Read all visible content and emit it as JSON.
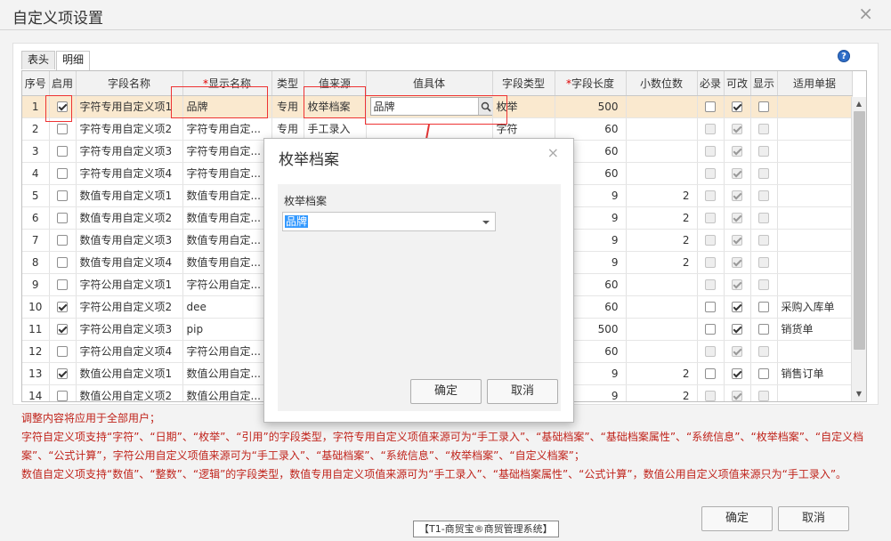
{
  "window": {
    "title": "自定义项设置",
    "close_glyph": "×"
  },
  "tabs": [
    {
      "label": "表头"
    },
    {
      "label": "明细"
    }
  ],
  "help_glyph": "?",
  "table": {
    "columns": [
      "序号",
      "启用",
      "字段名称",
      "显示名称",
      "类型",
      "值来源",
      "值具体",
      "字段类型",
      "字段长度",
      "小数位数",
      "必录",
      "可改",
      "显示",
      "适用单据"
    ],
    "required_mark": "*",
    "rows": [
      {
        "no": "1",
        "enabled": true,
        "field": "字符专用自定义项1",
        "display": "品牌",
        "type": "专用",
        "source": "枚举档案",
        "value": "品牌",
        "ftype": "枚举",
        "len": "500",
        "dec": "",
        "req": false,
        "edit": true,
        "show": false,
        "docs": ""
      },
      {
        "no": "2",
        "enabled": false,
        "field": "字符专用自定义项2",
        "display": "字符专用自定...",
        "type": "专用",
        "source": "手工录入",
        "value": "",
        "ftype": "字符",
        "len": "60",
        "dec": "",
        "req": false,
        "edit": true,
        "show": false,
        "docs": ""
      },
      {
        "no": "3",
        "enabled": false,
        "field": "字符专用自定义项3",
        "display": "字符专用自定...",
        "type": "",
        "source": "",
        "value": "",
        "ftype": "",
        "len": "60",
        "dec": "",
        "req": false,
        "edit": true,
        "show": false,
        "docs": ""
      },
      {
        "no": "4",
        "enabled": false,
        "field": "字符专用自定义项4",
        "display": "字符专用自定...",
        "type": "",
        "source": "",
        "value": "",
        "ftype": "",
        "len": "60",
        "dec": "",
        "req": false,
        "edit": true,
        "show": false,
        "docs": ""
      },
      {
        "no": "5",
        "enabled": false,
        "field": "数值专用自定义项1",
        "display": "数值专用自定...",
        "type": "",
        "source": "",
        "value": "",
        "ftype": "",
        "len": "9",
        "dec": "2",
        "req": false,
        "edit": true,
        "show": false,
        "docs": ""
      },
      {
        "no": "6",
        "enabled": false,
        "field": "数值专用自定义项2",
        "display": "数值专用自定...",
        "type": "",
        "source": "",
        "value": "",
        "ftype": "",
        "len": "9",
        "dec": "2",
        "req": false,
        "edit": true,
        "show": false,
        "docs": ""
      },
      {
        "no": "7",
        "enabled": false,
        "field": "数值专用自定义项3",
        "display": "数值专用自定...",
        "type": "",
        "source": "",
        "value": "",
        "ftype": "",
        "len": "9",
        "dec": "2",
        "req": false,
        "edit": true,
        "show": false,
        "docs": ""
      },
      {
        "no": "8",
        "enabled": false,
        "field": "数值专用自定义项4",
        "display": "数值专用自定...",
        "type": "",
        "source": "",
        "value": "",
        "ftype": "",
        "len": "9",
        "dec": "2",
        "req": false,
        "edit": true,
        "show": false,
        "docs": ""
      },
      {
        "no": "9",
        "enabled": false,
        "field": "字符公用自定义项1",
        "display": "字符公用自定...",
        "type": "",
        "source": "",
        "value": "",
        "ftype": "",
        "len": "60",
        "dec": "",
        "req": false,
        "edit": true,
        "show": false,
        "docs": ""
      },
      {
        "no": "10",
        "enabled": true,
        "field": "字符公用自定义项2",
        "display": "dee",
        "type": "",
        "source": "",
        "value": "",
        "ftype": "",
        "len": "60",
        "dec": "",
        "req": false,
        "edit": true,
        "show": false,
        "docs": "采购入库单"
      },
      {
        "no": "11",
        "enabled": true,
        "field": "字符公用自定义项3",
        "display": "pip",
        "type": "",
        "source": "",
        "value": "",
        "ftype": "",
        "len": "500",
        "dec": "",
        "req": false,
        "edit": true,
        "show": false,
        "docs": "销货单"
      },
      {
        "no": "12",
        "enabled": false,
        "field": "字符公用自定义项4",
        "display": "字符公用自定...",
        "type": "",
        "source": "",
        "value": "",
        "ftype": "",
        "len": "60",
        "dec": "",
        "req": false,
        "edit": true,
        "show": false,
        "docs": ""
      },
      {
        "no": "13",
        "enabled": true,
        "field": "数值公用自定义项1",
        "display": "数值公用自定...",
        "type": "",
        "source": "",
        "value": "",
        "ftype": "",
        "len": "9",
        "dec": "2",
        "req": false,
        "edit": true,
        "show": false,
        "docs": "销售订单"
      },
      {
        "no": "14",
        "enabled": false,
        "field": "数值公用自定义项2",
        "display": "数值公用自定...",
        "type": "",
        "source": "",
        "value": "",
        "ftype": "",
        "len": "9",
        "dec": "2",
        "req": false,
        "edit": true,
        "show": false,
        "docs": ""
      }
    ]
  },
  "dialog": {
    "title": "枚举档案",
    "close_glyph": "×",
    "field_label": "枚举档案",
    "selected": "品牌",
    "ok": "确定",
    "cancel": "取消"
  },
  "notes": [
    "调整内容将应用于全部用户；",
    "字符自定义项支持“字符”、“日期”、“枚举”、“引用”的字段类型，字符专用自定义项值来源可为“手工录入”、“基础档案”、“基础档案属性”、“系统信息”、“枚举档案”、“自定义档案”、“公式计算”，字符公用自定义项值来源可为“手工录入”、“基础档案”、“系统信息”、“枚举档案”、“自定义档案”；",
    "数值自定义项支持“数值”、“整数”、“逻辑”的字段类型，数值专用自定义项值来源可为“手工录入”、“基础档案属性”、“公式计算”，数值公用自定义项值来源只为“手工录入”。"
  ],
  "footer": {
    "ok": "确定",
    "cancel": "取消"
  },
  "status_tag": "【T1-商贸宝®商贸管理系统】",
  "colors": {
    "highlight": "#e33333",
    "selected_row": "#fae9cf",
    "note_text": "#c0231b"
  }
}
